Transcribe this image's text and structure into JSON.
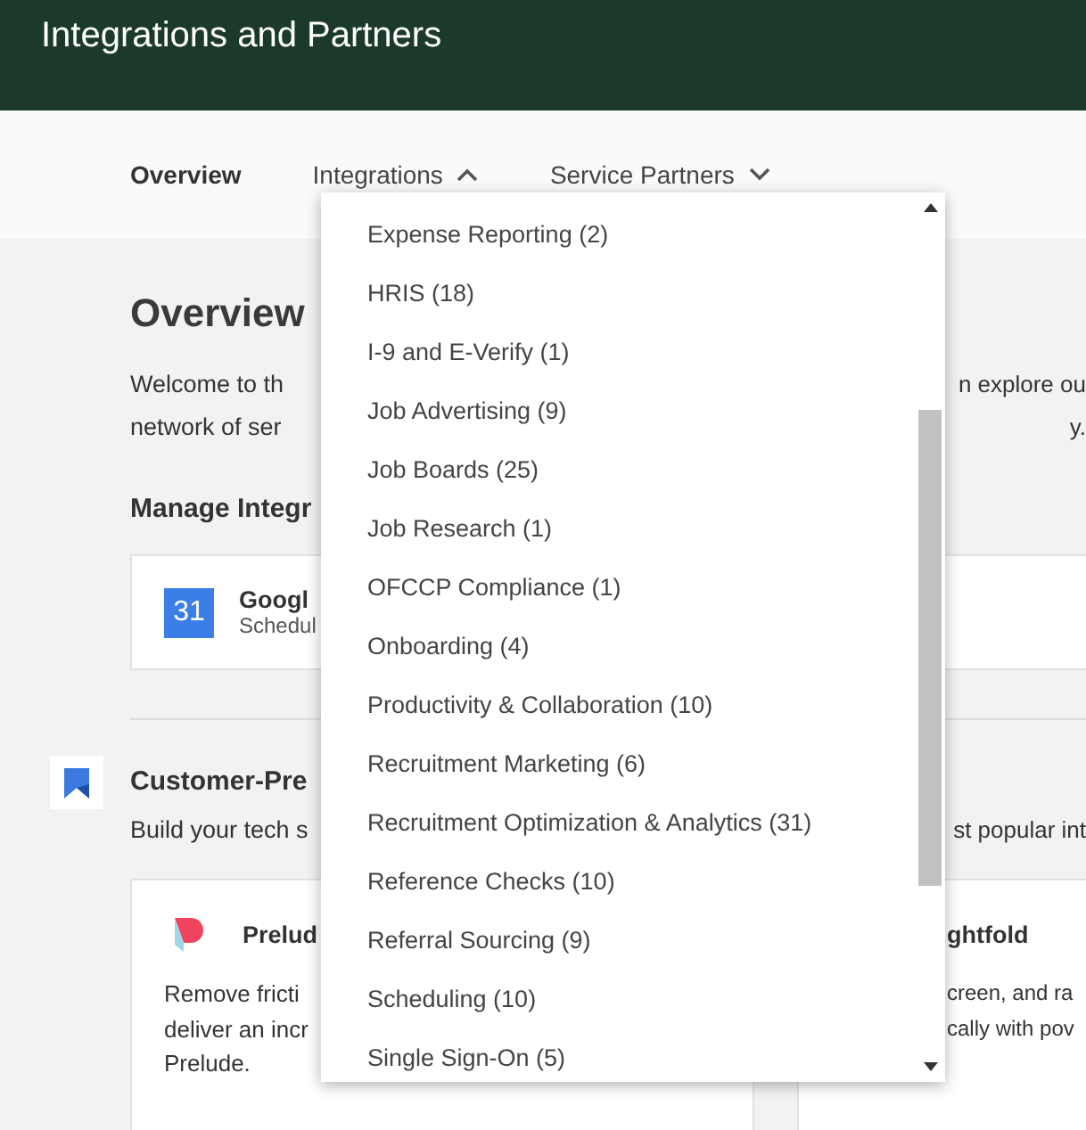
{
  "header": {
    "title": "Integrations and Partners"
  },
  "nav": [
    {
      "label": "Overview",
      "selected": true,
      "kind": "link"
    },
    {
      "label": "Integrations",
      "selected": false,
      "kind": "dropdown",
      "expanded": true
    },
    {
      "label": "Service Partners",
      "selected": false,
      "kind": "dropdown",
      "expanded": false
    }
  ],
  "dropdown_menu": {
    "items": [
      "Expense Reporting (2)",
      "HRIS (18)",
      "I-9 and E-Verify (1)",
      "Job Advertising (9)",
      "Job Boards (25)",
      "Job Research (1)",
      "OFCCP Compliance (1)",
      "Onboarding (4)",
      "Productivity & Collaboration (10)",
      "Recruitment Marketing (6)",
      "Recruitment Optimization & Analytics (31)",
      "Reference Checks (10)",
      "Referral Sourcing (9)",
      "Scheduling (10)",
      "Single Sign-On (5)"
    ]
  },
  "overview": {
    "heading": "Overview",
    "intro_lines": [
      {
        "left": "Welcome to th",
        "right": "n explore ou"
      },
      {
        "left": "network of ser",
        "right": "y."
      }
    ],
    "manage_heading": "Manage Integr",
    "integration_card": {
      "icon_text": "31",
      "name": "Googl",
      "subtitle": "Schedul"
    }
  },
  "customer_section": {
    "heading": "Customer-Pre",
    "description": {
      "left": "Build your tech s",
      "right": "st popular int"
    },
    "cards": [
      {
        "kind": "full",
        "name": "Prelud",
        "lines": [
          "Remove fricti",
          "deliver an incr",
          "Prelude."
        ]
      },
      {
        "kind": "covered",
        "name": "ghtfold",
        "lines": [
          "creen, and ra",
          "cally with pov"
        ]
      }
    ]
  }
}
